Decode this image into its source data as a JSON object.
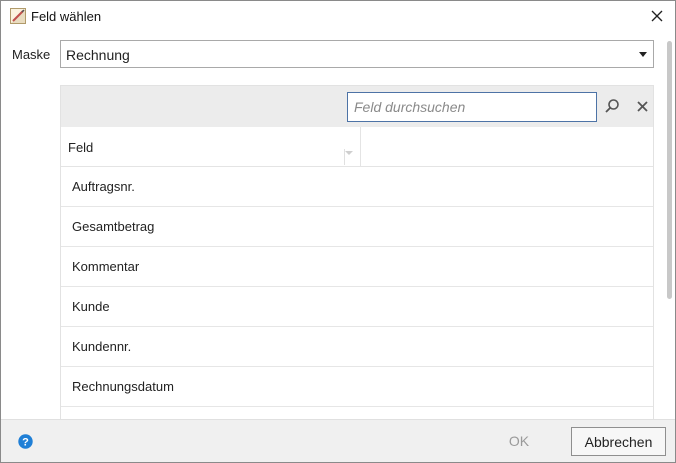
{
  "window": {
    "title": "Feld wählen",
    "app_icon": "document-edit-icon",
    "close_icon": "close-icon"
  },
  "mask": {
    "label": "Maske",
    "selected_value": "Rechnung",
    "dropdown_icon": "caret-down-icon"
  },
  "search": {
    "placeholder": "Feld durchsuchen",
    "value": "",
    "search_icon": "search-icon",
    "clear_icon": "clear-icon"
  },
  "table": {
    "column_header": "Feld",
    "sort_icon": "sort-down-icon",
    "rows": [
      "Auftragsnr.",
      "Gesamtbetrag",
      "Kommentar",
      "Kunde",
      "Kundennr.",
      "Rechnungsdatum"
    ]
  },
  "footer": {
    "help_icon": "help-icon",
    "ok_label": "OK",
    "cancel_label": "Abbrechen"
  },
  "colors": {
    "accent": "#4d73a6",
    "help": "#1f7fd6",
    "panel_bar": "#ececec",
    "footer": "#f0f0f0",
    "disabled_text": "#9a9a9a"
  }
}
